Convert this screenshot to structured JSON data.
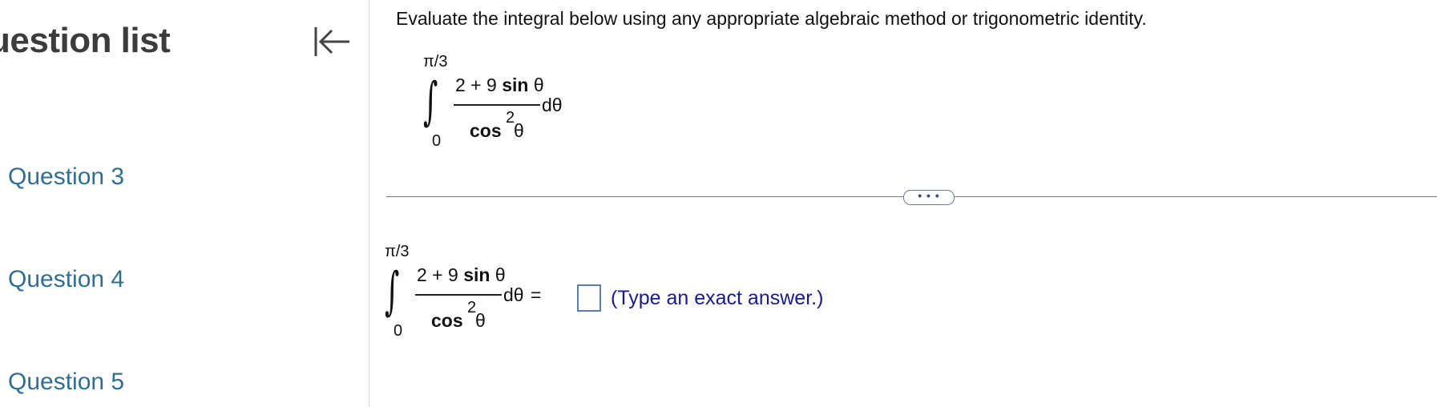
{
  "sidebar": {
    "title": "uestion list",
    "collapse_icon": "collapse-left-icon",
    "questions": [
      "Question 3",
      "Question 4",
      "Question 5"
    ]
  },
  "main": {
    "instructions": "Evaluate the integral below using any appropriate algebraic method or trigonometric identity.",
    "integral": {
      "upper": "π/3",
      "lower": "0",
      "integral_sign": "∫",
      "num_coeff": "2 + 9",
      "num_func": "sin",
      "num_var": "θ",
      "den_func": "cos",
      "den_exp": "2",
      "den_var": "θ",
      "differential": "dθ",
      "equals": "="
    },
    "more_button": "• • •",
    "answer_hint": "(Type an exact answer.)"
  },
  "colors": {
    "link": "#2f6f8f",
    "hint": "#1a1a8c",
    "box_border": "#5b7fa6"
  }
}
